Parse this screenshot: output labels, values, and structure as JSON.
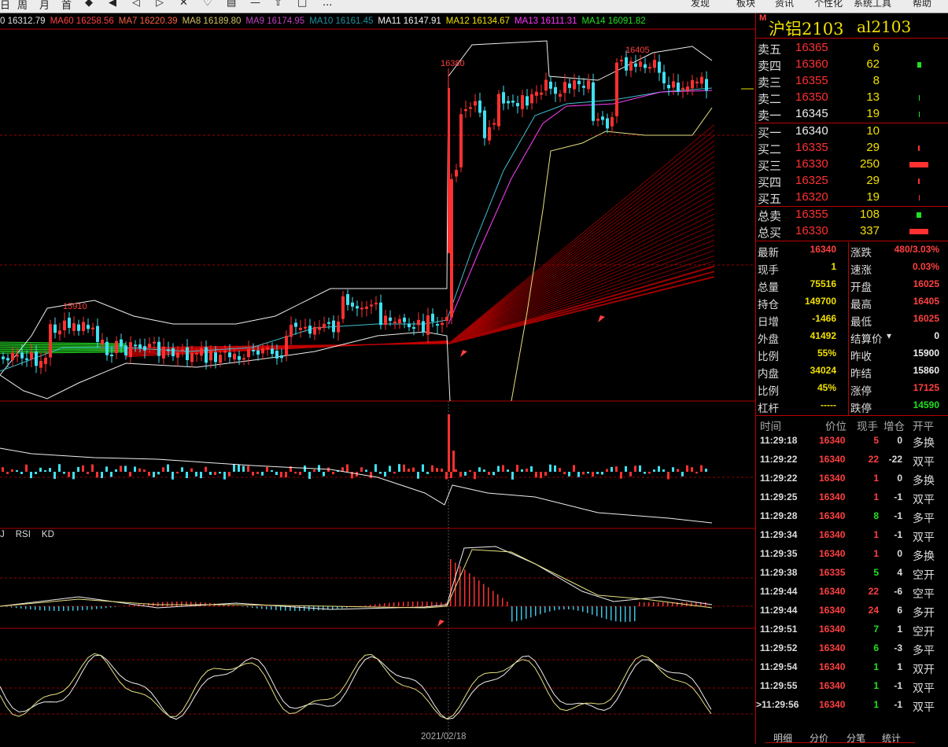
{
  "toolbar": {
    "items": [
      "日",
      "周",
      "月",
      "首",
      "◆",
      "◀",
      "◁",
      "▷",
      "✕",
      "♡",
      "▤",
      "—",
      "⇧",
      "□",
      "..."
    ],
    "right_items": [
      "发现",
      "板块",
      "资讯",
      "个性化",
      "系统工具",
      "帮助"
    ]
  },
  "ma_legend": [
    {
      "label": "0 16312.79",
      "color": "#e0e0e0"
    },
    {
      "label": "MA60 16258.56",
      "color": "#ff4040"
    },
    {
      "label": "MA7 16220.39",
      "color": "#ff6040"
    },
    {
      "label": "MA8 16189.80",
      "color": "#d0c060"
    },
    {
      "label": "MA9 16174.95",
      "color": "#c040c0"
    },
    {
      "label": "MA10 16161.45",
      "color": "#2090a0"
    },
    {
      "label": "MA11 16147.91",
      "color": "#f0f0f0"
    },
    {
      "label": "MA12 16134.67",
      "color": "#f0e000"
    },
    {
      "label": "MA13 16111.31",
      "color": "#ff30ff"
    },
    {
      "label": "MA14 16091.82",
      "color": "#20e020"
    }
  ],
  "chart_labels": {
    "high1": "16380",
    "high2": "16405",
    "low1": "15910"
  },
  "sub_legend": [
    "J",
    "RSI",
    "KD"
  ],
  "date_label": "2021/02/18",
  "instrument": {
    "name": "沪铝2103",
    "code": "al2103",
    "marker": "M"
  },
  "asks": [
    {
      "label": "卖五",
      "price": "16365",
      "vol": "6",
      "bar": 0
    },
    {
      "label": "卖四",
      "price": "16360",
      "vol": "62",
      "bar": 5
    },
    {
      "label": "卖三",
      "price": "16355",
      "vol": "8",
      "bar": 0
    },
    {
      "label": "卖二",
      "price": "16350",
      "vol": "13",
      "bar": 1
    },
    {
      "label": "卖一",
      "price": "16345",
      "vol": "19",
      "bar": 1
    }
  ],
  "bids": [
    {
      "label": "买一",
      "price": "16340",
      "vol": "10",
      "bar": 0
    },
    {
      "label": "买二",
      "price": "16335",
      "vol": "29",
      "bar": 2
    },
    {
      "label": "买三",
      "price": "16330",
      "vol": "250",
      "bar": 24
    },
    {
      "label": "买四",
      "price": "16325",
      "vol": "29",
      "bar": 2
    },
    {
      "label": "买五",
      "price": "16320",
      "vol": "19",
      "bar": 1
    }
  ],
  "totals": [
    {
      "label": "总卖",
      "price": "16355",
      "vol": "108",
      "bar": 6,
      "bar_color": "#20e020"
    },
    {
      "label": "总买",
      "price": "16330",
      "vol": "337",
      "bar": 24,
      "bar_color": "#ff3030"
    }
  ],
  "quote": [
    {
      "l1": "最新",
      "v1": "16340",
      "c1": "#ff4040",
      "l2": "涨跌",
      "v2": "480/3.03%",
      "c2": "#ff4040"
    },
    {
      "l1": "现手",
      "v1": "1",
      "c1": "#f0e000",
      "l2": "速涨",
      "v2": "0.03%",
      "c2": "#ff4040"
    },
    {
      "l1": "总量",
      "v1": "75516",
      "c1": "#f0e000",
      "l2": "开盘",
      "v2": "16025",
      "c2": "#ff4040"
    },
    {
      "l1": "持仓",
      "v1": "149700",
      "c1": "#f0e000",
      "l2": "最高",
      "v2": "16405",
      "c2": "#ff4040"
    },
    {
      "l1": "日增",
      "v1": "-1466",
      "c1": "#f0e000",
      "l2": "最低",
      "v2": "16025",
      "c2": "#ff4040"
    },
    {
      "l1": "外盘",
      "v1": "41492",
      "c1": "#f0e000",
      "l2": "结算价",
      "v2": "0",
      "c2": "#eeeeee"
    },
    {
      "l1": "比例",
      "v1": "55%",
      "c1": "#f0e000",
      "l2": "昨收",
      "v2": "15900",
      "c2": "#eeeeee"
    },
    {
      "l1": "内盘",
      "v1": "34024",
      "c1": "#f0e000",
      "l2": "昨结",
      "v2": "15860",
      "c2": "#eeeeee"
    },
    {
      "l1": "比例",
      "v1": "45%",
      "c1": "#f0e000",
      "l2": "涨停",
      "v2": "17125",
      "c2": "#ff4040"
    },
    {
      "l1": "杠杆",
      "v1": "-----",
      "c1": "#f0e000",
      "l2": "跌停",
      "v2": "14590",
      "c2": "#20e020"
    }
  ],
  "ticks_head": [
    "时间",
    "价位",
    "现手",
    "增仓",
    "开平"
  ],
  "ticks": [
    {
      "time": "11:29:18",
      "price": "16340",
      "hand": "5",
      "hc": "#ff4040",
      "zeng": "0",
      "kai": "多换"
    },
    {
      "time": "11:29:22",
      "price": "16340",
      "hand": "22",
      "hc": "#ff4040",
      "zeng": "-22",
      "kai": "双平"
    },
    {
      "time": "11:29:22",
      "price": "16340",
      "hand": "1",
      "hc": "#ff4040",
      "zeng": "0",
      "kai": "多换"
    },
    {
      "time": "11:29:25",
      "price": "16340",
      "hand": "1",
      "hc": "#ff4040",
      "zeng": "-1",
      "kai": "双平"
    },
    {
      "time": "11:29:28",
      "price": "16340",
      "hand": "8",
      "hc": "#20e020",
      "zeng": "-1",
      "kai": "多平"
    },
    {
      "time": "11:29:34",
      "price": "16340",
      "hand": "1",
      "hc": "#ff4040",
      "zeng": "-1",
      "kai": "双平"
    },
    {
      "time": "11:29:35",
      "price": "16340",
      "hand": "1",
      "hc": "#ff4040",
      "zeng": "0",
      "kai": "多换"
    },
    {
      "time": "11:29:38",
      "price": "16335",
      "hand": "5",
      "hc": "#20e020",
      "zeng": "4",
      "kai": "空开"
    },
    {
      "time": "11:29:44",
      "price": "16340",
      "hand": "22",
      "hc": "#ff4040",
      "zeng": "-6",
      "kai": "空平"
    },
    {
      "time": "11:29:44",
      "price": "16340",
      "hand": "24",
      "hc": "#ff4040",
      "zeng": "6",
      "kai": "多开"
    },
    {
      "time": "11:29:51",
      "price": "16340",
      "hand": "7",
      "hc": "#20e020",
      "zeng": "1",
      "kai": "空开"
    },
    {
      "time": "11:29:52",
      "price": "16340",
      "hand": "6",
      "hc": "#20e020",
      "zeng": "-3",
      "kai": "多平"
    },
    {
      "time": "11:29:54",
      "price": "16340",
      "hand": "1",
      "hc": "#20e020",
      "zeng": "1",
      "kai": "双开"
    },
    {
      "time": "11:29:55",
      "price": "16340",
      "hand": "1",
      "hc": "#20e020",
      "zeng": "-1",
      "kai": "双平"
    },
    {
      "time": ">11:29:56",
      "price": "16340",
      "hand": "1",
      "hc": "#20e020",
      "zeng": "-1",
      "kai": "双平"
    }
  ],
  "tabs": [
    "明细",
    "分价",
    "分笔",
    "统计"
  ]
}
